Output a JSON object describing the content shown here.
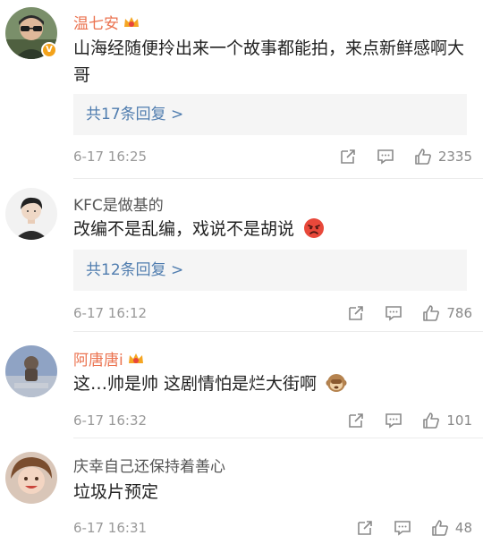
{
  "comments": [
    {
      "username": "温七安",
      "text": "山海经随便拎出来一个故事都能拍，来点新鲜感啊大哥",
      "replies": "共17条回复 >",
      "time": "6-17 16:25",
      "likes": "2335",
      "verified_badge": "V",
      "username_color": "#eb7350"
    },
    {
      "username": "KFC是做基的",
      "text": "改编不是乱编，戏说不是胡说",
      "replies": "共12条回复 >",
      "time": "6-17 16:12",
      "likes": "786",
      "emoji": "angry-face-emoji"
    },
    {
      "username": "阿唐唐i",
      "text": "这…帅是帅 这剧情怕是烂大街啊",
      "time": "6-17 16:32",
      "likes": "101",
      "emoji": "monkey-emoji",
      "username_color": "#eb7350"
    },
    {
      "username": "庆幸自己还保持着善心",
      "text": "垃圾片预定",
      "time": "6-17 16:31",
      "likes": "48"
    }
  ],
  "icons": {
    "share": "share-icon",
    "comment": "comment-icon",
    "like": "thumbs-up-icon",
    "vip": "vip-crown-icon"
  },
  "colors": {
    "link": "#507daf",
    "vip_name": "#eb7350",
    "meta": "#999999"
  }
}
